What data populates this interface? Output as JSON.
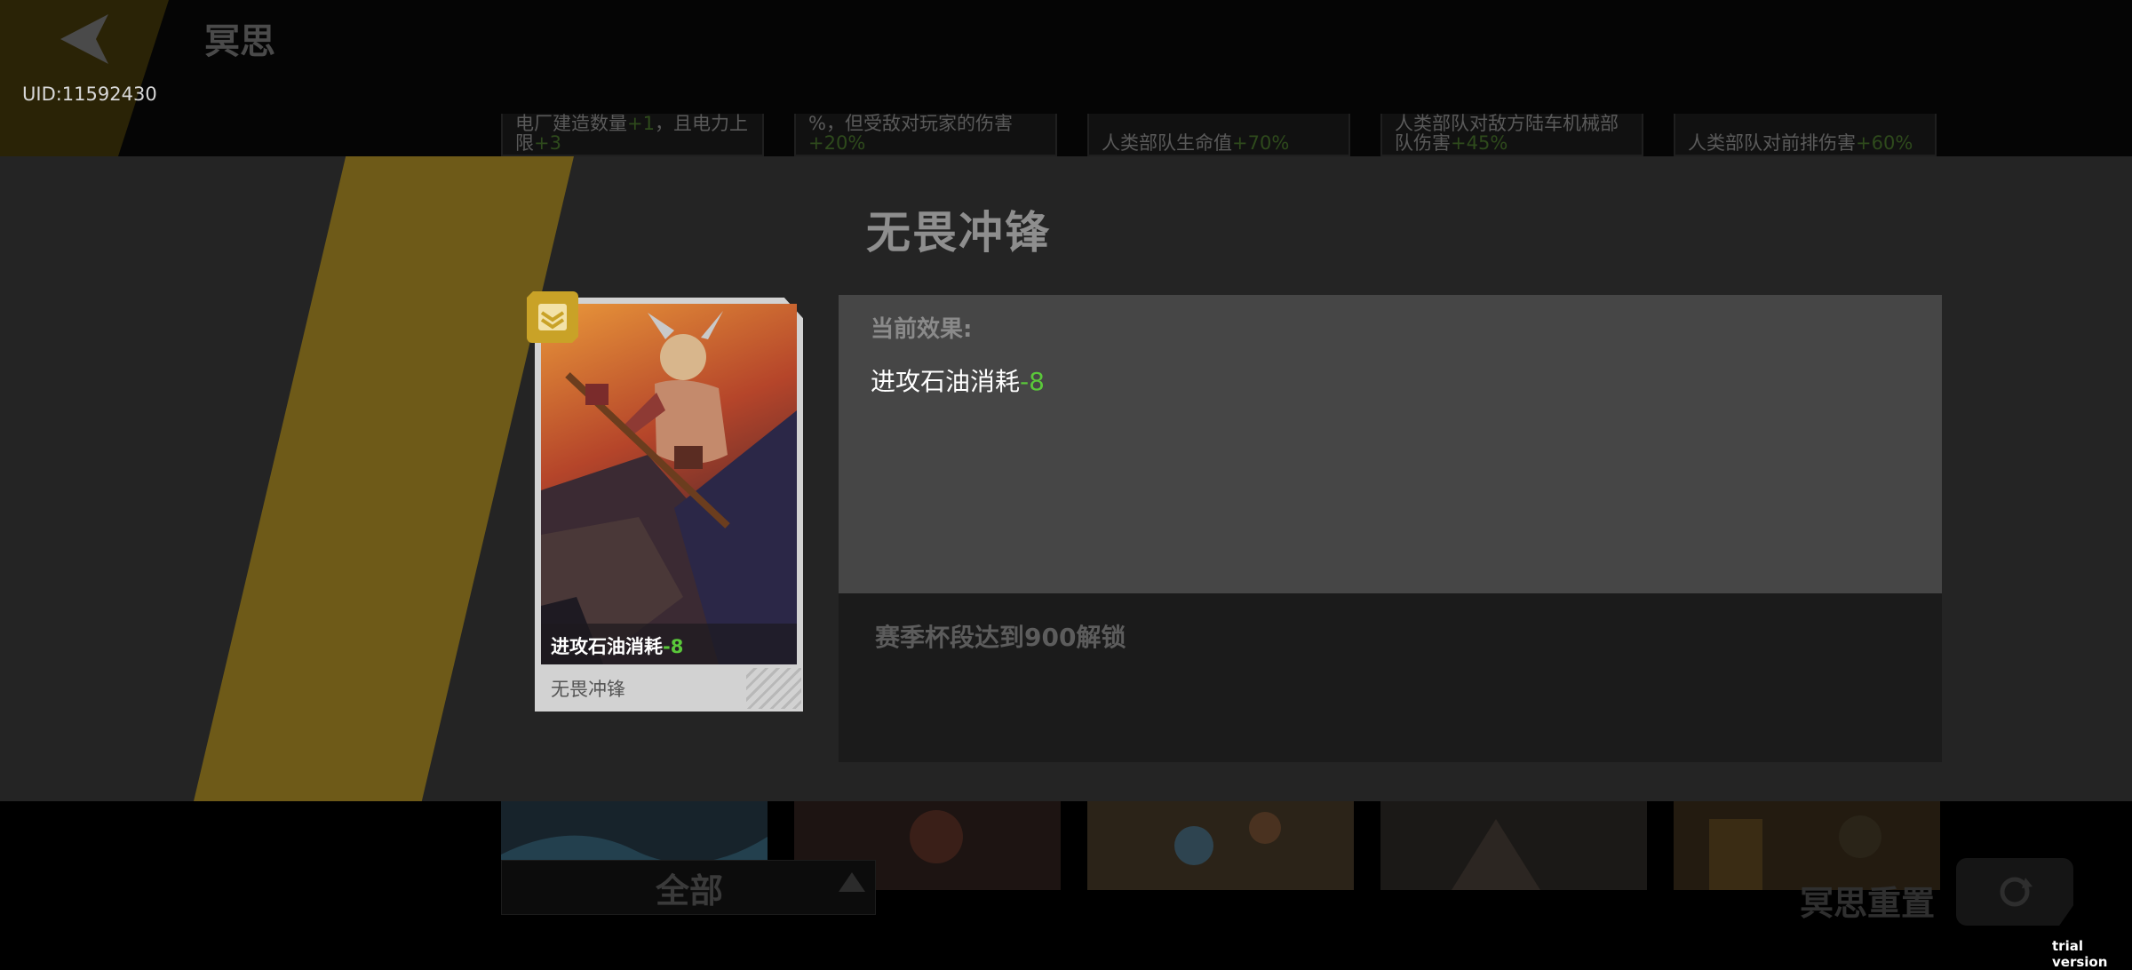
{
  "header": {
    "title": "冥思",
    "uid": "UID:11592430"
  },
  "background_strip": [
    {
      "text": "电厂建造数量",
      "highlight": "+1",
      "text2": "，且电力上限",
      "highlight2": "+3"
    },
    {
      "text": "%，但受敌对玩家的伤害",
      "highlight": "+20%",
      "text2": "",
      "highlight2": ""
    },
    {
      "text": "人类部队生命值",
      "highlight": "+70%",
      "text2": "",
      "highlight2": ""
    },
    {
      "text": "人类部队对敌方陆车机械部队伤害",
      "highlight": "+45%",
      "text2": "",
      "highlight2": ""
    },
    {
      "text": "人类部队对前排伤害",
      "highlight": "+60%",
      "text2": "",
      "highlight2": ""
    }
  ],
  "modal": {
    "title": "无畏冲锋",
    "card": {
      "effect_text": "进攻石油消耗",
      "effect_value": "-8",
      "name": "无畏冲锋"
    },
    "panel": {
      "heading": "当前效果:",
      "effect_text": "进攻石油消耗",
      "effect_value": "-8",
      "unlock_condition": "赛季杯段达到900解锁"
    }
  },
  "bottom": {
    "filter_label": "全部",
    "reset_label": "冥思重置"
  },
  "watermark": "trial version",
  "colors": {
    "accent_yellow": "#6e5a18",
    "badge_gold": "#c9a227",
    "value_green": "#5ac83a",
    "panel_bg": "#464646"
  },
  "icons": {
    "back": "back-arrow-icon",
    "badge": "chevron-badge-icon",
    "filter": "triangle-up-icon",
    "reset": "refresh-icon"
  }
}
